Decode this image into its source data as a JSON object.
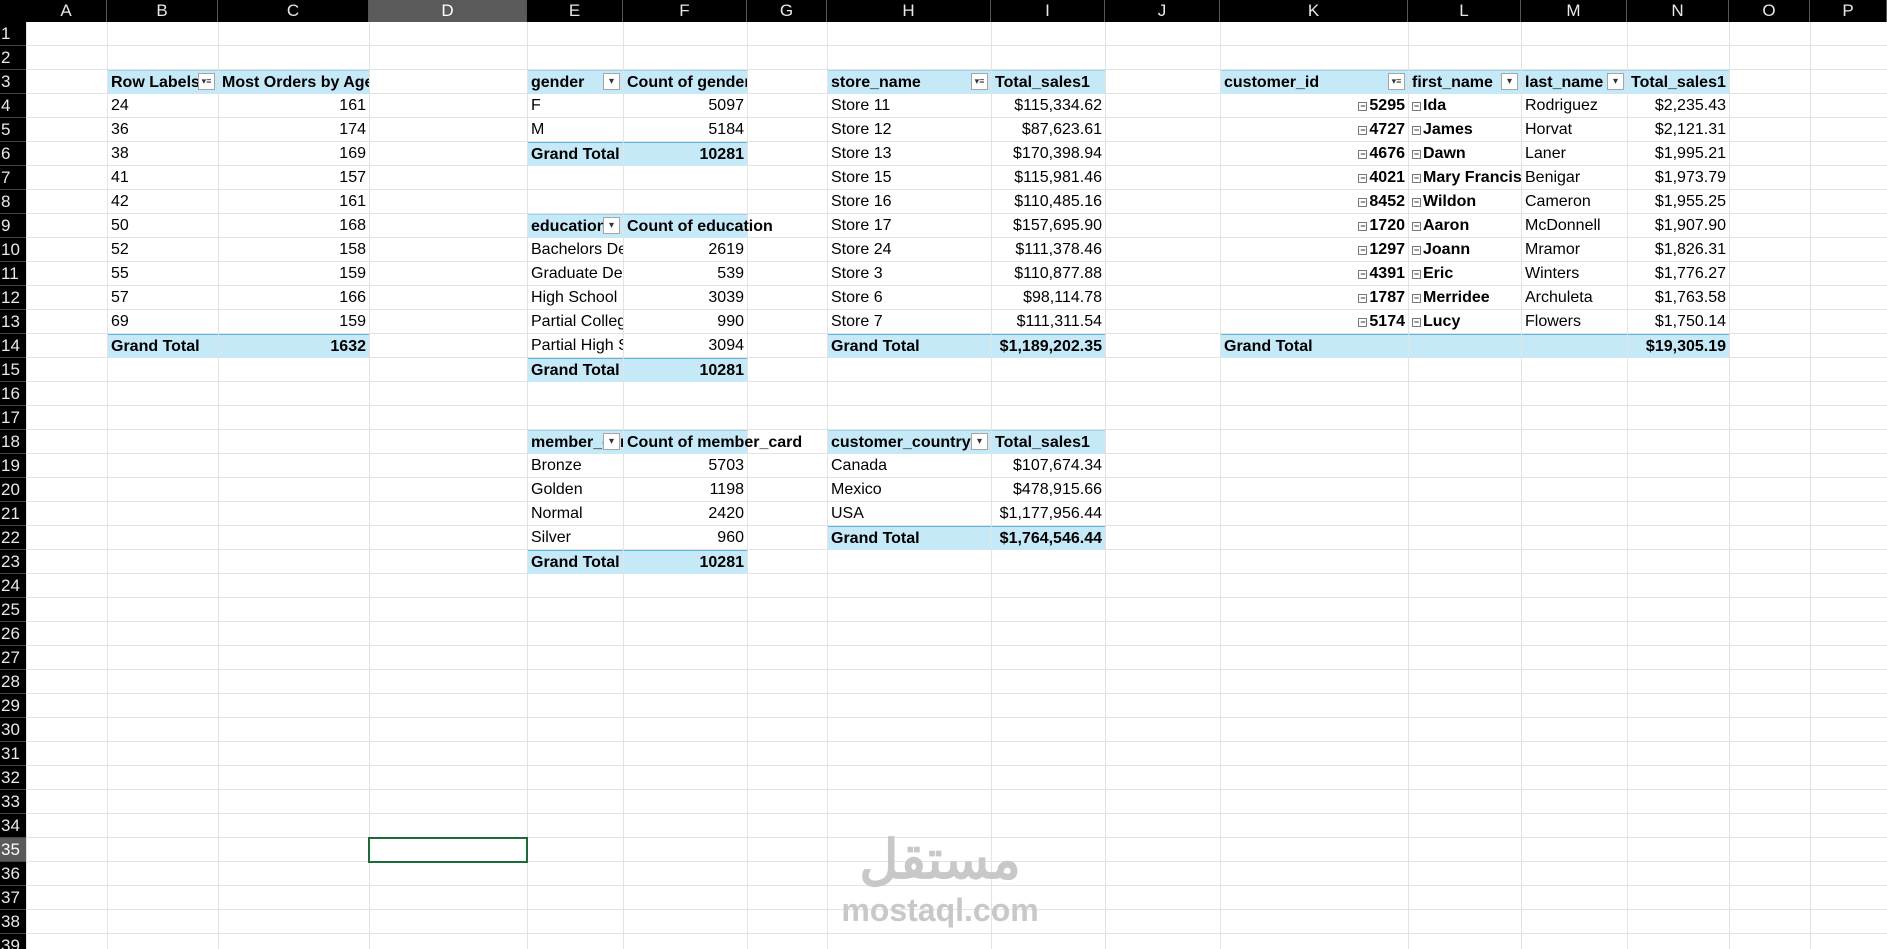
{
  "columns": [
    "A",
    "B",
    "C",
    "D",
    "E",
    "F",
    "G",
    "H",
    "I",
    "J",
    "K",
    "L",
    "M",
    "N",
    "O",
    "P"
  ],
  "selected_column": "D",
  "selected_row": 35,
  "rows": [
    1,
    2,
    3,
    4,
    5,
    6,
    7,
    8,
    9,
    10,
    11,
    12,
    13,
    14,
    15,
    16,
    17,
    18,
    19,
    20,
    21,
    22,
    23,
    24,
    25,
    26,
    27,
    28,
    29,
    30,
    31,
    32,
    33,
    34,
    35,
    36,
    37,
    38,
    39
  ],
  "pivot_age": {
    "headers": [
      "Row Labels",
      "Most Orders by Age"
    ],
    "rows": [
      [
        "24",
        "161"
      ],
      [
        "36",
        "174"
      ],
      [
        "38",
        "169"
      ],
      [
        "41",
        "157"
      ],
      [
        "42",
        "161"
      ],
      [
        "50",
        "168"
      ],
      [
        "52",
        "158"
      ],
      [
        "55",
        "159"
      ],
      [
        "57",
        "166"
      ],
      [
        "69",
        "159"
      ]
    ],
    "total_label": "Grand Total",
    "total_value": "1632"
  },
  "pivot_gender": {
    "headers": [
      "gender",
      "Count of gender"
    ],
    "rows": [
      [
        "F",
        "5097"
      ],
      [
        "M",
        "5184"
      ]
    ],
    "total_label": "Grand Total",
    "total_value": "10281"
  },
  "pivot_education": {
    "headers": [
      "education",
      "Count of education"
    ],
    "rows": [
      [
        "Bachelors Degree",
        "2619"
      ],
      [
        "Graduate Degree",
        "539"
      ],
      [
        "High School Degree",
        "3039"
      ],
      [
        "Partial College",
        "990"
      ],
      [
        "Partial High School",
        "3094"
      ]
    ],
    "total_label": "Grand Total",
    "total_value": "10281"
  },
  "pivot_member": {
    "headers": [
      "member_card",
      "Count of member_card"
    ],
    "rows": [
      [
        "Bronze",
        "5703"
      ],
      [
        "Golden",
        "1198"
      ],
      [
        "Normal",
        "2420"
      ],
      [
        "Silver",
        "960"
      ]
    ],
    "total_label": "Grand Total",
    "total_value": "10281"
  },
  "pivot_store": {
    "headers": [
      "store_name",
      "Total_sales1"
    ],
    "rows": [
      [
        "Store 11",
        "$115,334.62"
      ],
      [
        "Store 12",
        "$87,623.61"
      ],
      [
        "Store 13",
        "$170,398.94"
      ],
      [
        "Store 15",
        "$115,981.46"
      ],
      [
        "Store 16",
        "$110,485.16"
      ],
      [
        "Store 17",
        "$157,695.90"
      ],
      [
        "Store 24",
        "$111,378.46"
      ],
      [
        "Store 3",
        "$110,877.88"
      ],
      [
        "Store 6",
        "$98,114.78"
      ],
      [
        "Store 7",
        "$111,311.54"
      ]
    ],
    "total_label": "Grand Total",
    "total_value": "$1,189,202.35"
  },
  "pivot_country": {
    "headers": [
      "customer_country",
      "Total_sales1"
    ],
    "rows": [
      [
        "Canada",
        "$107,674.34"
      ],
      [
        "Mexico",
        "$478,915.66"
      ],
      [
        "USA",
        "$1,177,956.44"
      ]
    ],
    "total_label": "Grand Total",
    "total_value": "$1,764,546.44"
  },
  "pivot_customer": {
    "headers": [
      "customer_id",
      "first_name",
      "last_name",
      "Total_sales1"
    ],
    "rows": [
      [
        "5295",
        "Ida",
        "Rodriguez",
        "$2,235.43"
      ],
      [
        "4727",
        "James",
        "Horvat",
        "$2,121.31"
      ],
      [
        "4676",
        "Dawn",
        "Laner",
        "$1,995.21"
      ],
      [
        "4021",
        "Mary Francis",
        "Benigar",
        "$1,973.79"
      ],
      [
        "8452",
        "Wildon",
        "Cameron",
        "$1,955.25"
      ],
      [
        "1720",
        "Aaron",
        "McDonnell",
        "$1,907.90"
      ],
      [
        "1297",
        "Joann",
        "Mramor",
        "$1,826.31"
      ],
      [
        "4391",
        "Eric",
        "Winters",
        "$1,776.27"
      ],
      [
        "1787",
        "Merridee",
        "Archuleta",
        "$1,763.58"
      ],
      [
        "5174",
        "Lucy",
        "Flowers",
        "$1,750.14"
      ]
    ],
    "total_label": "Grand Total",
    "total_value": "$19,305.19"
  },
  "icons": {
    "filter_active": "filter-icon",
    "dropdown": "dropdown-arrow-icon",
    "collapse": "collapse-icon"
  },
  "colors": {
    "pivot_header": "#c6e9f8",
    "selection": "#1e6b3a",
    "header_bar": "#000000"
  },
  "watermark": {
    "arabic": "مستقل",
    "latin": "mostaql.com"
  }
}
